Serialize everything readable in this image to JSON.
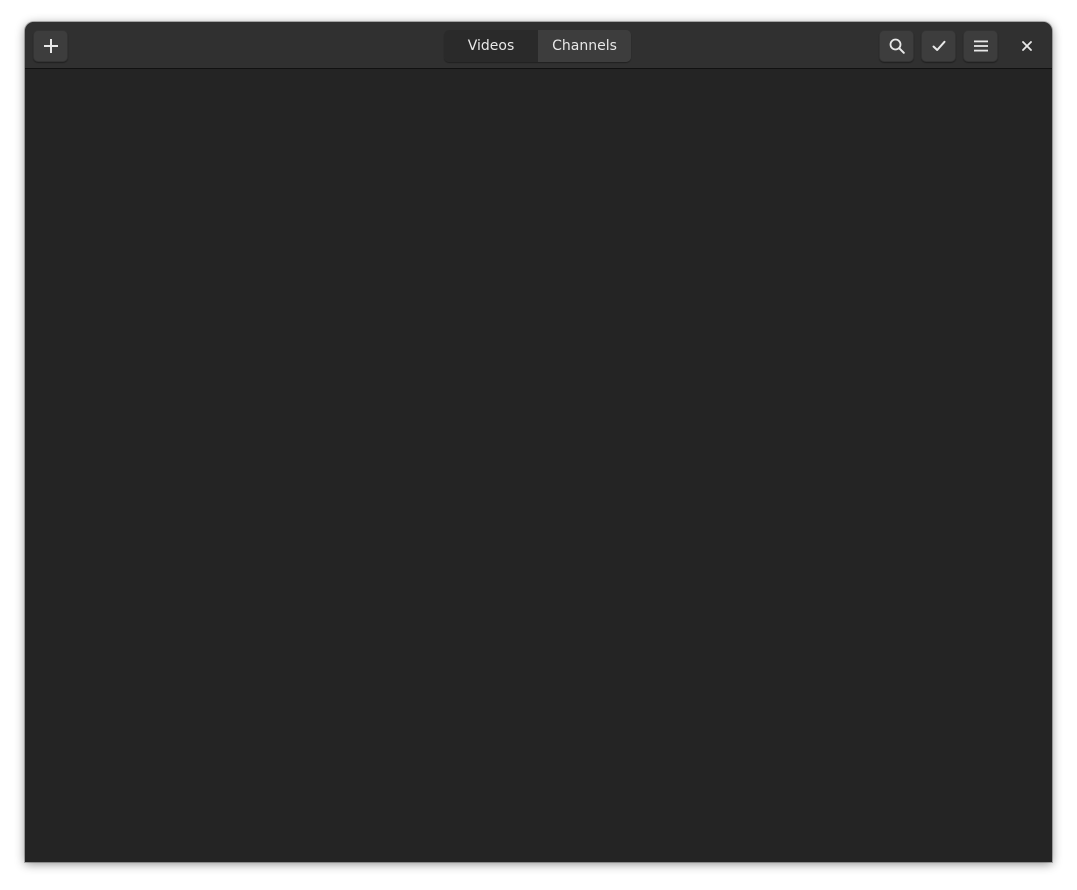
{
  "headerbar": {
    "add_icon": "plus-icon",
    "view_switcher": {
      "tabs": [
        {
          "label": "Videos",
          "active": true
        },
        {
          "label": "Channels",
          "active": false
        }
      ]
    },
    "search_icon": "search-icon",
    "select_icon": "checkmark-icon",
    "menu_icon": "hamburger-menu-icon",
    "close_icon": "close-icon"
  },
  "colors": {
    "window_bg": "#242424",
    "headerbar_bg": "#303030",
    "button_bg": "#3d3d3d",
    "text": "#e8e8e8"
  }
}
